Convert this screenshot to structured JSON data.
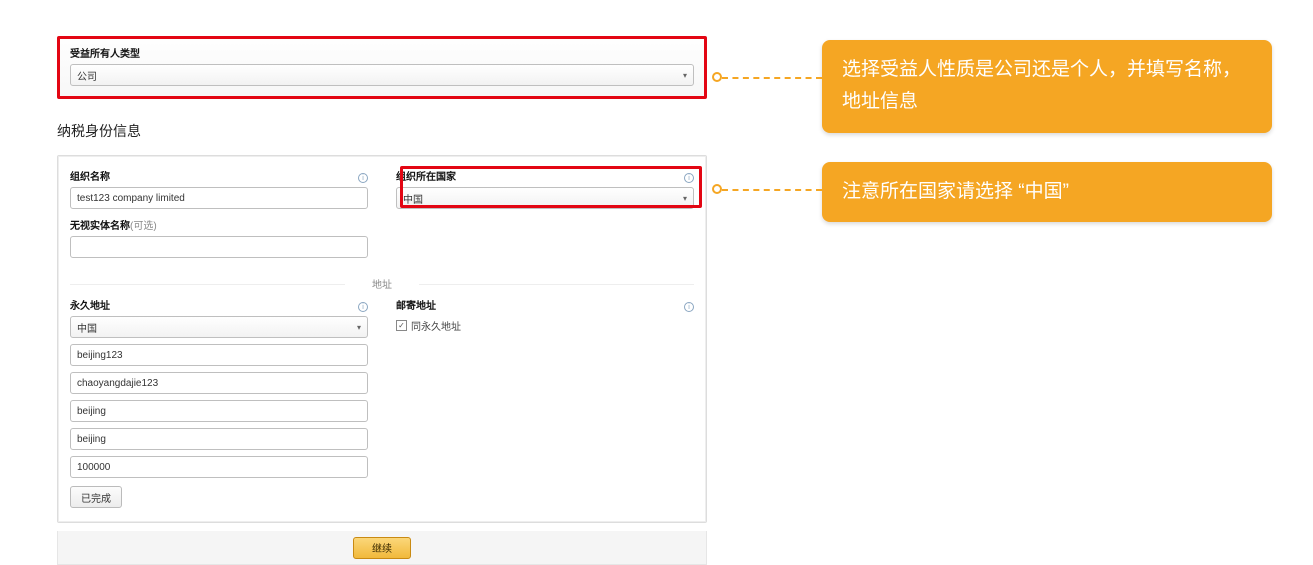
{
  "beneficiary": {
    "label": "受益所有人类型",
    "value": "公司"
  },
  "tax_section_title": "纳税身份信息",
  "org": {
    "name_label": "组织名称",
    "name_value": "test123 company limited",
    "disregarded_label": "无视实体名称",
    "disregarded_optional": "(可选)",
    "disregarded_value": "",
    "country_label": "组织所在国家",
    "country_value": "中国"
  },
  "address_header": "地址",
  "perm_address": {
    "label": "永久地址",
    "country": "中国",
    "line1": "beijing123",
    "line2": "chaoyangdajie123",
    "city": "beijing",
    "state": "beijing",
    "postal": "100000",
    "done_label": "已完成"
  },
  "mail_address": {
    "label": "邮寄地址",
    "same_as_label": "同永久地址",
    "same_as_checked": true
  },
  "continue_label": "继续",
  "callouts": {
    "c1": "选择受益人性质是公司还是个人，并填写名称，地址信息",
    "c2": "注意所在国家请选择 “中国”"
  }
}
